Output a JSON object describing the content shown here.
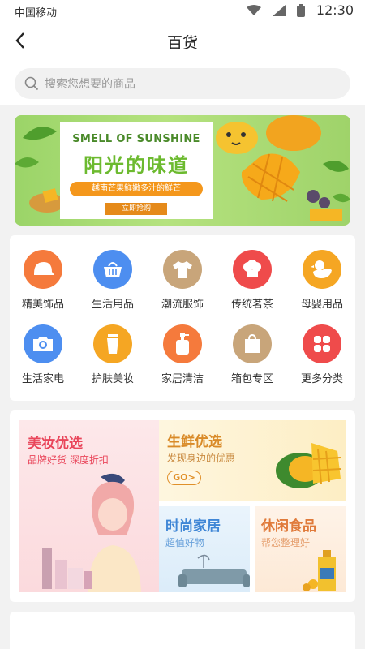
{
  "status_bar": {
    "carrier": "中国移动",
    "time": "12:30"
  },
  "header": {
    "title": "百货"
  },
  "search": {
    "placeholder": "搜索您想要的商品"
  },
  "banner": {
    "en_title": "SMELL OF SUNSHINE",
    "cn_title": "阳光的味道",
    "subtitle": "越南芒果鲜嫩多汁的鲜芒",
    "button": "立即抢购"
  },
  "categories": [
    {
      "label": "精美饰品",
      "icon": "cap-icon",
      "color": "#f57a3c"
    },
    {
      "label": "生活用品",
      "icon": "basket-icon",
      "color": "#4d8ef0"
    },
    {
      "label": "潮流服饰",
      "icon": "shirt-icon",
      "color": "#c8a57a"
    },
    {
      "label": "传统茗茶",
      "icon": "cake-icon",
      "color": "#ef4b4b"
    },
    {
      "label": "母婴用品",
      "icon": "duck-icon",
      "color": "#f5a623"
    },
    {
      "label": "生活家电",
      "icon": "camera-icon",
      "color": "#4d8ef0"
    },
    {
      "label": "护肤美妆",
      "icon": "cosmetic-icon",
      "color": "#f5a623"
    },
    {
      "label": "家居清洁",
      "icon": "bottle-icon",
      "color": "#f57a3c"
    },
    {
      "label": "箱包专区",
      "icon": "bag-icon",
      "color": "#c8a57a"
    },
    {
      "label": "更多分类",
      "icon": "grid-icon",
      "color": "#ef4b4b"
    }
  ],
  "promos": {
    "beauty": {
      "title": "美妆优选",
      "subtitle": "品牌好货 深度折扣"
    },
    "fresh": {
      "title": "生鲜优选",
      "subtitle": "发现身边的优惠",
      "button": "GO>"
    },
    "home": {
      "title": "时尚家居",
      "subtitle": "超值好物"
    },
    "snack": {
      "title": "休闲食品",
      "subtitle": "帮您整理好"
    }
  },
  "colors": {
    "accent": "#f5a623",
    "beauty_red": "#e9455a",
    "fresh_orange": "#e0902a"
  }
}
